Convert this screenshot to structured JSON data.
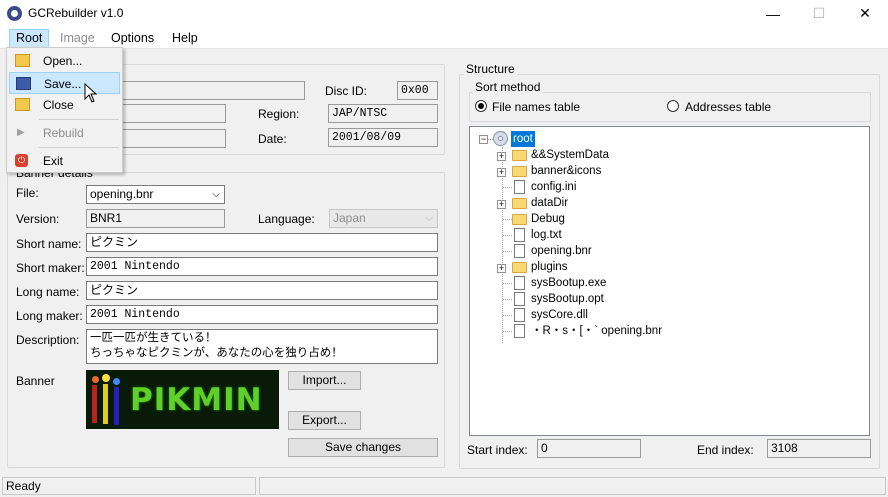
{
  "window": {
    "title": "GCRebuilder v1.0",
    "min_glyph": "—",
    "max_glyph": "☐",
    "close_glyph": "✕"
  },
  "menubar": {
    "root": "Root",
    "image": "Image",
    "options": "Options",
    "help": "Help"
  },
  "root_menu": {
    "items": [
      {
        "label": "Open...",
        "icon": "folder-open-icon",
        "enabled": true
      },
      {
        "label": "Save...",
        "icon": "floppy-save-icon",
        "enabled": true,
        "highlighted": true
      },
      {
        "label": "Close",
        "icon": "folder-close-icon",
        "enabled": true
      },
      {
        "label": "Rebuild",
        "icon": "play-arrow-icon",
        "enabled": false
      },
      {
        "label": "Exit",
        "icon": "power-icon",
        "enabled": true
      }
    ]
  },
  "image_info": {
    "disc_id_label": "Disc ID:",
    "disc_id": "0x00",
    "region_label": "Region:",
    "region": "JAP/NTSC",
    "date_label": "Date:",
    "date": "2001/08/09"
  },
  "banner": {
    "group_title": "Banner details",
    "file_label": "File:",
    "file": "opening.bnr",
    "version_label": "Version:",
    "version": "BNR1",
    "language_label": "Language:",
    "language": "Japan",
    "short_name_label": "Short name:",
    "short_name": "ピクミン",
    "short_maker_label": "Short maker:",
    "short_maker": "2001 Nintendo",
    "long_name_label": "Long name:",
    "long_name": "ピクミン",
    "long_maker_label": "Long maker:",
    "long_maker": "2001 Nintendo",
    "description_label": "Description:",
    "description_line1": "一匹一匹が生きている！",
    "description_line2": "ちっちゃなピクミンが、あなたの心を独り占め！",
    "banner_label": "Banner",
    "banner_image_text": "PIKMIN",
    "import_button": "Import...",
    "export_button": "Export...",
    "save_button": "Save changes"
  },
  "structure": {
    "group_title": "Structure",
    "sort_title": "Sort method",
    "sort_file_names": "File names table",
    "sort_addresses": "Addresses table",
    "tree": [
      {
        "name": "root",
        "type": "disc",
        "expandable": true,
        "selected": true
      },
      {
        "name": "&&SystemData",
        "type": "folder",
        "expandable": true
      },
      {
        "name": "banner&icons",
        "type": "folder",
        "expandable": true
      },
      {
        "name": "config.ini",
        "type": "file"
      },
      {
        "name": "dataDir",
        "type": "folder",
        "expandable": true
      },
      {
        "name": "Debug",
        "type": "folder"
      },
      {
        "name": "log.txt",
        "type": "file"
      },
      {
        "name": "opening.bnr",
        "type": "file"
      },
      {
        "name": "plugins",
        "type": "folder",
        "expandable": true
      },
      {
        "name": "sysBootup.exe",
        "type": "file"
      },
      {
        "name": "sysBootup.opt",
        "type": "file"
      },
      {
        "name": "sysCore.dll",
        "type": "file"
      },
      {
        "name": "・R・s・[・` opening.bnr",
        "type": "file"
      }
    ],
    "start_index_label": "Start index:",
    "start_index": "0",
    "end_index_label": "End index:",
    "end_index": "3108"
  },
  "status": {
    "text": "Ready"
  },
  "colors": {
    "accent_selection": "#0078d7",
    "menu_highlight": "#cce8ff"
  }
}
